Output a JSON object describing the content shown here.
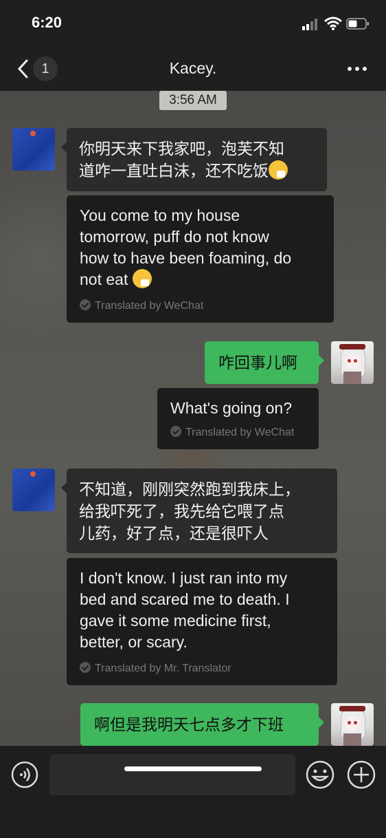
{
  "status_bar": {
    "time": "6:20"
  },
  "nav": {
    "back_badge": "1",
    "title": "Kacey."
  },
  "chat": {
    "timestamp": "3:56 AM",
    "messages": [
      {
        "side": "left",
        "text_line1": "你明天来下我家吧，泡芙不知",
        "text_line2": "道咋一直吐白沫，还不吃饭",
        "translation_lines": [
          "You come to my house",
          "tomorrow, puff do not know",
          "how to have been foaming, do",
          "not eat"
        ],
        "translated_by": "Translated by WeChat"
      },
      {
        "side": "right",
        "text": "咋回事儿啊",
        "translation": "What's going on?",
        "translated_by": "Translated by WeChat"
      },
      {
        "side": "left",
        "text_lines": [
          "不知道，刚刚突然跑到我床上，",
          "给我吓死了，我先给它喂了点",
          "儿药，好了点，还是很吓人"
        ],
        "translation_lines": [
          "I don't know. I just ran into my",
          "bed and scared me to death. I",
          "gave it some medicine first,",
          "better, or scary."
        ],
        "translated_by": "Translated by Mr. Translator"
      },
      {
        "side": "right",
        "text": "啊但是我明天七点多才下班"
      }
    ]
  },
  "icons": {
    "back": "chevron-left-icon",
    "more": "more-dots-icon",
    "voice": "voice-icon",
    "emoji": "emoji-icon",
    "plus": "plus-icon",
    "emoji_inline": "drooling-sick-face-emoji"
  },
  "colors": {
    "green_bubble": "#3fb75d",
    "dark_bubble": "#2b2b2b",
    "bar": "#1f1f1f"
  }
}
